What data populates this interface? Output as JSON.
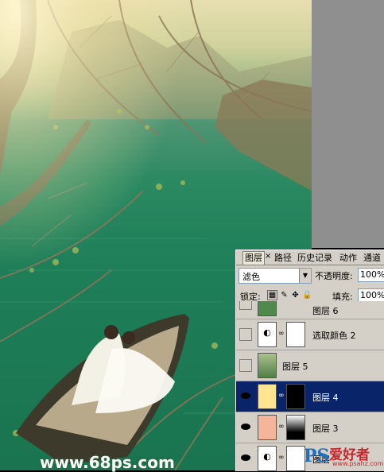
{
  "panel": {
    "tabs": [
      "图层",
      "路径",
      "历史记录",
      "动作",
      "通道"
    ],
    "close_glyph": "×",
    "blend_mode": "滤色",
    "opacity_label": "不透明度:",
    "opacity_value": "100%",
    "lock_label": "锁定:",
    "fill_label": "填充:",
    "fill_value": "100%"
  },
  "layers": [
    {
      "name": "图层 6",
      "visible": false,
      "selected": false,
      "thumb_color": "#4f8a4c",
      "has_mask": false
    },
    {
      "name": "选取颜色 2",
      "visible": false,
      "selected": false,
      "thumb_color": "#ffffff",
      "has_mask": true,
      "adjustment": true
    },
    {
      "name": "图层 5",
      "visible": false,
      "selected": false,
      "thumb_color": "#6e9a5a",
      "has_mask": false
    },
    {
      "name": "图层 4",
      "visible": true,
      "selected": true,
      "thumb_color": "#ffe58f",
      "has_mask": true,
      "mask_color": "#000000"
    },
    {
      "name": "图层 3",
      "visible": true,
      "selected": false,
      "thumb_color": "#f5b59a",
      "has_mask": true,
      "mask_color": "#000000"
    },
    {
      "name": "图层",
      "visible": true,
      "selected": false,
      "thumb_color": "#ffffff",
      "has_mask": true,
      "adjustment": true
    }
  ],
  "watermark": {
    "left_text": "www.68ps.com",
    "right_logo": "PS",
    "right_text": "爱好者",
    "right_url": "www.psahz.com"
  },
  "colors": {
    "selected_row": "#0a246a",
    "water": "#1f7f58",
    "panel_bg": "#d4d0c8"
  }
}
